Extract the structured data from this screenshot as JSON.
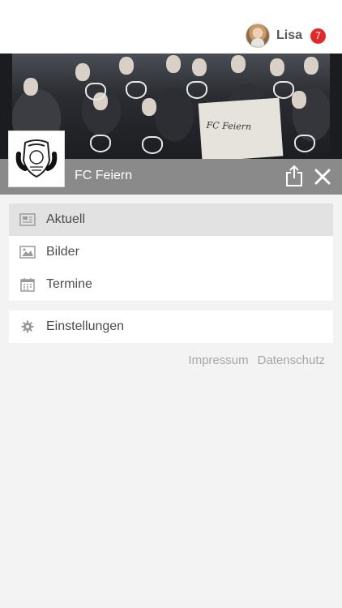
{
  "header": {
    "user_name": "Lisa",
    "notification_count": "7"
  },
  "club": {
    "name": "FC Feiern",
    "banner_text": "FC Feiern"
  },
  "menu": {
    "items": [
      {
        "label": "Aktuell",
        "icon": "newspaper-icon",
        "active": true
      },
      {
        "label": "Bilder",
        "icon": "image-icon",
        "active": false
      },
      {
        "label": "Termine",
        "icon": "calendar-icon",
        "active": false
      }
    ],
    "settings": {
      "label": "Einstellungen",
      "icon": "gear-icon"
    }
  },
  "footer": {
    "links": [
      "Impressum",
      "Datenschutz"
    ]
  },
  "colors": {
    "badge": "#e02a2a",
    "club_bar": "#8a8a8a",
    "active_item": "#e2e2e2",
    "background": "#f3f3f3"
  }
}
